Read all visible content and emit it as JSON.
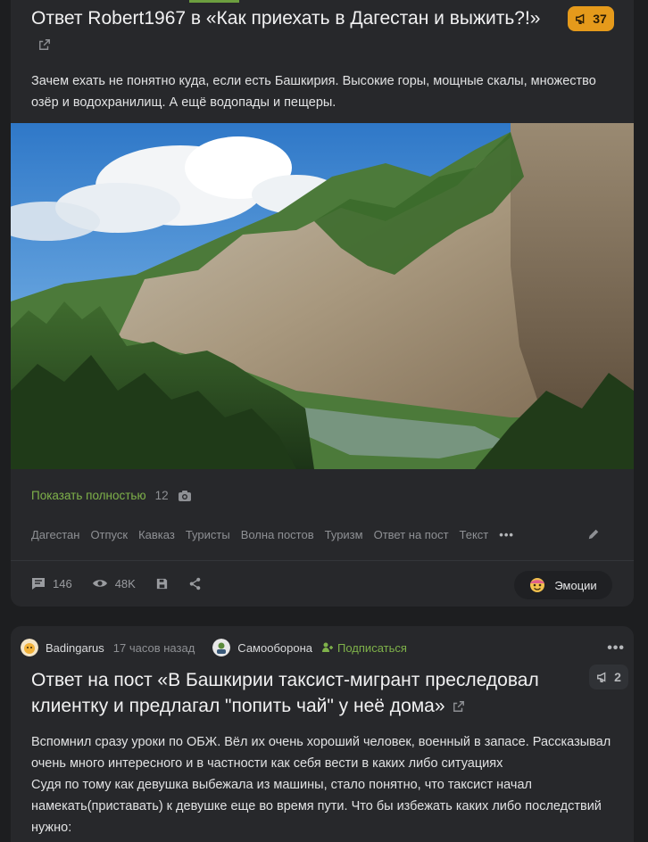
{
  "post1": {
    "title": "Ответ Robert1967 в «Как приехать в Дагестан и выжить?!»",
    "rating": "37",
    "text": "Зачем ехать не понятно куда, если есть Башкирия. Высокие горы, мощные скалы, множество озёр и водохранилищ. А ещё водопады и пещеры.",
    "show_more": "Показать полностью",
    "photo_count": "12",
    "tags": [
      "Дагестан",
      "Отпуск",
      "Кавказ",
      "Туристы",
      "Волна постов",
      "Туризм",
      "Ответ на пост",
      "Текст"
    ],
    "tags_more": "•••",
    "comments": "146",
    "views": "48K",
    "emotions_label": "Эмоции"
  },
  "post2": {
    "author": "Badingarus",
    "time": "17 часов назад",
    "community": "Самооборона",
    "subscribe": "Подписаться",
    "more": "•••",
    "title": "Ответ на пост «В Башкирии таксист-мигрант преследовал клиентку и предлагал \"попить чай\" у неё дома»",
    "rating": "2",
    "text_lines": [
      "Вспомнил сразу уроки по ОБЖ. Вёл их очень хороший человек, военный в запасе. Рассказывал",
      "очень много интересного и в частности как себя вести в каких либо ситуациях",
      "Судя по тому как девушка выбежала из машины, стало понятно, что таксист начал",
      "намекать(приставать) к девушке еще во время пути. Что бы избежать каких либо последствий",
      "нужно:"
    ]
  },
  "colors": {
    "background": "#1d1e20",
    "card": "#27282b",
    "accent_green": "#7fb24a",
    "hot_rating": "#e59a1b"
  }
}
